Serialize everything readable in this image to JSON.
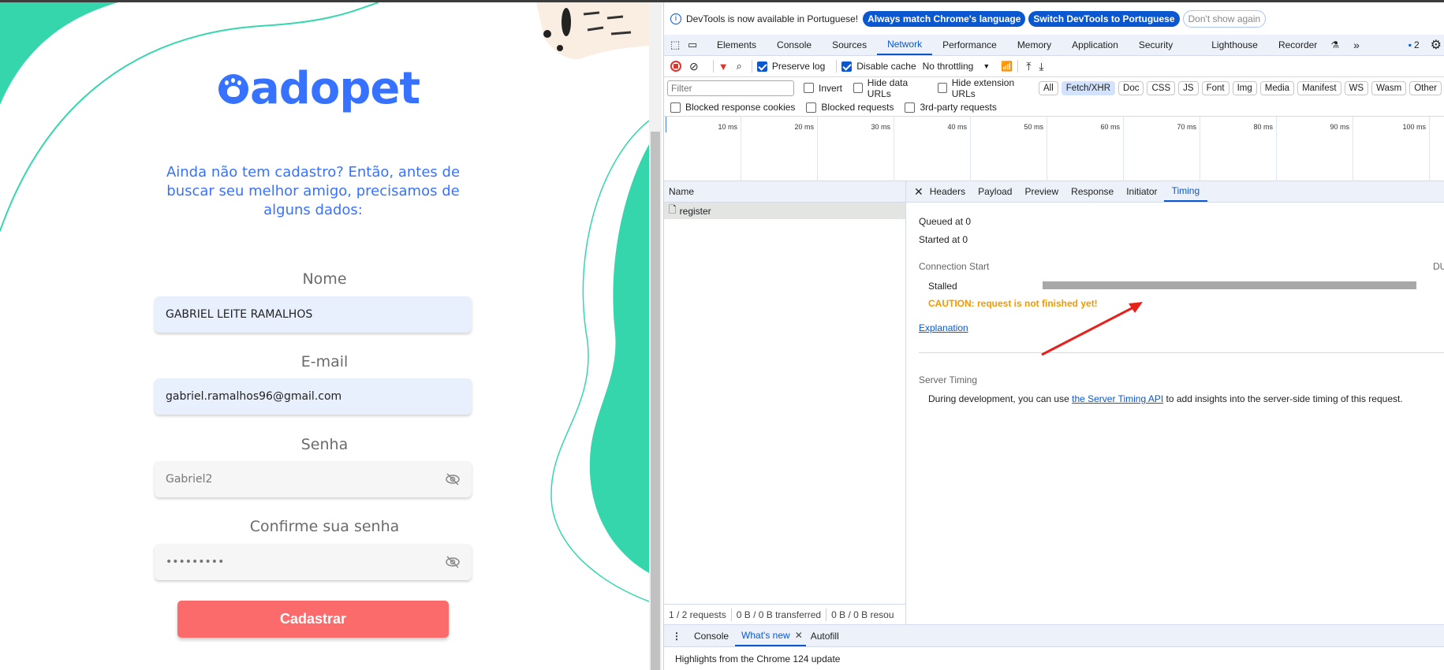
{
  "app": {
    "logo": "adopet",
    "intro": "Ainda não tem cadastro? Então, antes de buscar seu melhor amigo, precisamos de alguns dados:",
    "fields": [
      {
        "label": "Nome",
        "value": "GABRIEL LEITE RAMALHOS"
      },
      {
        "label": "E-mail",
        "value": "gabriel.ramalhos96@gmail.com"
      },
      {
        "label": "Senha",
        "value": "Gabriel2"
      },
      {
        "label": "Confirme sua senha",
        "value": "•••••••••"
      }
    ],
    "submit": "Cadastrar",
    "colors": {
      "brand": "#3772ff",
      "accent": "#36d6ad",
      "button": "#fc6b6b"
    }
  },
  "devtools": {
    "banner": {
      "text": "DevTools is now available in Portuguese!",
      "btn1": "Always match Chrome's language",
      "btn2": "Switch DevTools to Portuguese",
      "btn3": "Don't show again"
    },
    "tabs": [
      "Elements",
      "Console",
      "Sources",
      "Network",
      "Performance",
      "Memory",
      "Application",
      "Security",
      "Lighthouse",
      "Recorder"
    ],
    "issues_count": "2",
    "toolbar": {
      "preserve_log": "Preserve log",
      "disable_cache": "Disable cache",
      "throttling": "No throttling"
    },
    "filter": {
      "placeholder": "Filter",
      "invert": "Invert",
      "hide_data": "Hide data URLs",
      "hide_ext": "Hide extension URLs",
      "types": [
        "All",
        "Fetch/XHR",
        "Doc",
        "CSS",
        "JS",
        "Font",
        "Img",
        "Media",
        "Manifest",
        "WS",
        "Wasm",
        "Other"
      ]
    },
    "filter2": [
      "Blocked response cookies",
      "Blocked requests",
      "3rd-party requests"
    ],
    "timeline_ticks": [
      "10 ms",
      "20 ms",
      "30 ms",
      "40 ms",
      "50 ms",
      "60 ms",
      "70 ms",
      "80 ms",
      "90 ms",
      "100 ms"
    ],
    "name_header": "Name",
    "request": "register",
    "detail_tabs": [
      "Headers",
      "Payload",
      "Preview",
      "Response",
      "Initiator",
      "Timing"
    ],
    "timing": {
      "queued": "Queued at 0",
      "started": "Started at 0",
      "conn": "Connection Start",
      "dur": "DU",
      "stalled": "Stalled",
      "caution": "CAUTION: request is not finished yet!",
      "explanation": "Explanation",
      "server": "Server Timing",
      "during_pre": "During development, you can use ",
      "during_link": "the Server Timing API",
      "during_post": " to add insights into the server-side timing of this request."
    },
    "status": [
      "1 / 2 requests",
      "0 B / 0 B transferred",
      "0 B / 0 B resou"
    ],
    "drawer_tabs": [
      "Console",
      "What's new",
      "Autofill"
    ],
    "highlights": "Highlights from the Chrome 124 update"
  }
}
